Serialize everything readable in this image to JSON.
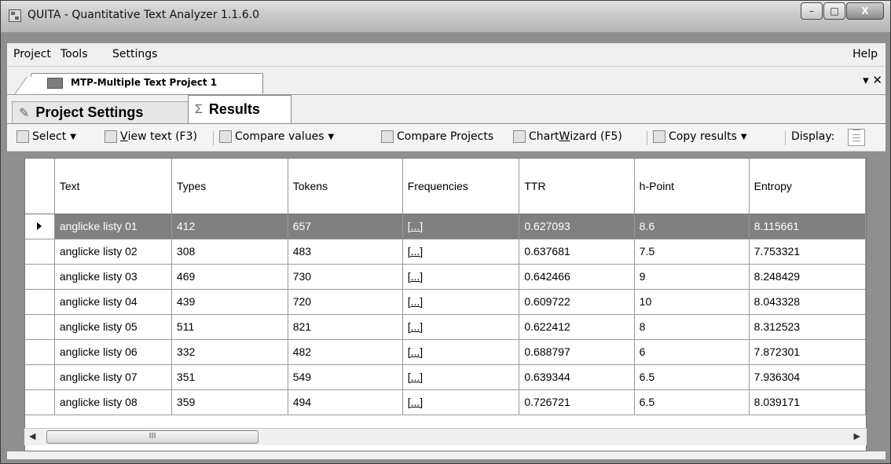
{
  "window": {
    "title": "QUITA - Quantitative Text Analyzer 1.1.6.0",
    "minimize_glyph": "–",
    "maximize_glyph": "□",
    "close_glyph": "X"
  },
  "menu": {
    "items": [
      "Project",
      "Tools",
      "Settings"
    ],
    "help": "Help"
  },
  "document_tab": {
    "label": "MTP-Multiple Text Project 1",
    "dropdown_glyph": "▾",
    "close_glyph": "✕"
  },
  "tabs": [
    {
      "label": "Project Settings",
      "icon": "wrench-icon",
      "selected": false
    },
    {
      "label": "Results",
      "icon": "sigma-icon",
      "glyph": "Σ",
      "selected": true
    }
  ],
  "toolbar": {
    "select": "Select",
    "view_text_prefix": "",
    "view_text_u": "V",
    "view_text_rest": "iew text (F3)",
    "compare_values": "Compare values",
    "compare_projects": "Compare Projects",
    "chart_wizard_prefix": "Chart ",
    "chart_wizard_u": "W",
    "chart_wizard_rest": "izard (F5)",
    "copy_results": "Copy results",
    "display": "Display:"
  },
  "grid": {
    "columns": [
      "Text",
      "Types",
      "Tokens",
      "Frequencies",
      "TTR",
      "h-Point",
      "Entropy"
    ],
    "rows": [
      {
        "text": "anglicke listy 01",
        "types": "412",
        "tokens": "657",
        "freq": "[...]",
        "ttr": "0.627093",
        "hpoint": "8.6",
        "entropy": "8.115661",
        "selected": true
      },
      {
        "text": "anglicke listy 02",
        "types": "308",
        "tokens": "483",
        "freq": "[...]",
        "ttr": "0.637681",
        "hpoint": "7.5",
        "entropy": "7.753321",
        "selected": false
      },
      {
        "text": "anglicke listy 03",
        "types": "469",
        "tokens": "730",
        "freq": "[...]",
        "ttr": "0.642466",
        "hpoint": "9",
        "entropy": "8.248429",
        "selected": false
      },
      {
        "text": "anglicke listy 04",
        "types": "439",
        "tokens": "720",
        "freq": "[...]",
        "ttr": "0.609722",
        "hpoint": "10",
        "entropy": "8.043328",
        "selected": false
      },
      {
        "text": "anglicke listy 05",
        "types": "511",
        "tokens": "821",
        "freq": "[...]",
        "ttr": "0.622412",
        "hpoint": "8",
        "entropy": "8.312523",
        "selected": false
      },
      {
        "text": "anglicke listy 06",
        "types": "332",
        "tokens": "482",
        "freq": "[...]",
        "ttr": "0.688797",
        "hpoint": "6",
        "entropy": "7.872301",
        "selected": false
      },
      {
        "text": "anglicke listy 07",
        "types": "351",
        "tokens": "549",
        "freq": "[...]",
        "ttr": "0.639344",
        "hpoint": "6.5",
        "entropy": "7.936304",
        "selected": false
      },
      {
        "text": "anglicke listy 08",
        "types": "359",
        "tokens": "494",
        "freq": "[...]",
        "ttr": "0.726721",
        "hpoint": "6.5",
        "entropy": "8.039171",
        "selected": false
      }
    ]
  },
  "scrollbar": {
    "thumb_grip": "III"
  },
  "colors": {
    "selected_row": "#808080",
    "window_frame": "#8f8f8f"
  }
}
